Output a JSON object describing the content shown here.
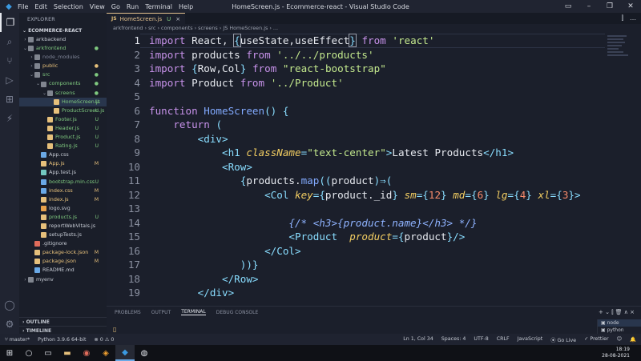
{
  "window": {
    "title": "HomeScreen.js - Ecommerce-react - Visual Studio Code",
    "menu": [
      "File",
      "Edit",
      "Selection",
      "View",
      "Go",
      "Run",
      "Terminal",
      "Help"
    ]
  },
  "sidebar": {
    "header": "EXPLORER",
    "section": "ECOMMERCE-REACT",
    "items": [
      {
        "name": "arkbackend",
        "indent": 0,
        "chev": "›",
        "icon": "folder-icon",
        "color": "plain",
        "badge": "",
        "sel": false
      },
      {
        "name": "arkfrontend",
        "indent": 0,
        "chev": "⌄",
        "icon": "folder-open-icon",
        "color": "green",
        "badge": "●",
        "sel": false
      },
      {
        "name": "node_modules",
        "indent": 1,
        "chev": "›",
        "icon": "folder-icon",
        "color": "grey",
        "badge": "",
        "sel": false
      },
      {
        "name": "public",
        "indent": 1,
        "chev": "›",
        "icon": "folder-icon",
        "color": "yellow",
        "badge": "●",
        "sel": false
      },
      {
        "name": "src",
        "indent": 1,
        "chev": "⌄",
        "icon": "folder-open-icon",
        "color": "green",
        "badge": "●",
        "sel": false
      },
      {
        "name": "components",
        "indent": 2,
        "chev": "⌄",
        "icon": "folder-open-icon",
        "color": "green",
        "badge": "●",
        "sel": false
      },
      {
        "name": "screens",
        "indent": 3,
        "chev": "⌄",
        "icon": "folder-open-icon",
        "color": "green",
        "badge": "●",
        "sel": false
      },
      {
        "name": "HomeScreen.js",
        "indent": 4,
        "chev": "",
        "icon": "js-file-icon",
        "color": "green",
        "badge": "U",
        "sel": true
      },
      {
        "name": "ProductScreen.js",
        "indent": 4,
        "chev": "",
        "icon": "js-file-icon",
        "color": "green",
        "badge": "U",
        "sel": false
      },
      {
        "name": "Footer.js",
        "indent": 3,
        "chev": "",
        "icon": "js-file-icon",
        "color": "green",
        "badge": "U",
        "sel": false
      },
      {
        "name": "Header.js",
        "indent": 3,
        "chev": "",
        "icon": "js-file-icon",
        "color": "green",
        "badge": "U",
        "sel": false
      },
      {
        "name": "Product.js",
        "indent": 3,
        "chev": "",
        "icon": "js-file-icon",
        "color": "green",
        "badge": "U",
        "sel": false
      },
      {
        "name": "Rating.js",
        "indent": 3,
        "chev": "",
        "icon": "js-file-icon",
        "color": "green",
        "badge": "U",
        "sel": false
      },
      {
        "name": "App.css",
        "indent": 2,
        "chev": "",
        "icon": "css-file-icon",
        "color": "plain",
        "badge": "",
        "sel": false
      },
      {
        "name": "App.js",
        "indent": 2,
        "chev": "",
        "icon": "js-file-icon",
        "color": "yellow",
        "badge": "M",
        "sel": false
      },
      {
        "name": "App.test.js",
        "indent": 2,
        "chev": "",
        "icon": "test-file-icon",
        "color": "plain",
        "badge": "",
        "sel": false
      },
      {
        "name": "bootstrap.min.css",
        "indent": 2,
        "chev": "",
        "icon": "css-file-icon",
        "color": "green",
        "badge": "U",
        "sel": false
      },
      {
        "name": "index.css",
        "indent": 2,
        "chev": "",
        "icon": "css-file-icon",
        "color": "yellow",
        "badge": "M",
        "sel": false
      },
      {
        "name": "index.js",
        "indent": 2,
        "chev": "",
        "icon": "js-file-icon",
        "color": "yellow",
        "badge": "M",
        "sel": false
      },
      {
        "name": "logo.svg",
        "indent": 2,
        "chev": "",
        "icon": "svg-file-icon",
        "color": "plain",
        "badge": "",
        "sel": false
      },
      {
        "name": "products.js",
        "indent": 2,
        "chev": "",
        "icon": "js-file-icon",
        "color": "green",
        "badge": "U",
        "sel": false
      },
      {
        "name": "reportWebVitals.js",
        "indent": 2,
        "chev": "",
        "icon": "js-file-icon",
        "color": "plain",
        "badge": "",
        "sel": false
      },
      {
        "name": "setupTests.js",
        "indent": 2,
        "chev": "",
        "icon": "js-file-icon",
        "color": "plain",
        "badge": "",
        "sel": false
      },
      {
        "name": ".gitignore",
        "indent": 1,
        "chev": "",
        "icon": "git-file-icon",
        "color": "plain",
        "badge": "",
        "sel": false
      },
      {
        "name": "package-lock.json",
        "indent": 1,
        "chev": "",
        "icon": "json-file-icon",
        "color": "yellow",
        "badge": "M",
        "sel": false
      },
      {
        "name": "package.json",
        "indent": 1,
        "chev": "",
        "icon": "json-file-icon",
        "color": "yellow",
        "badge": "M",
        "sel": false
      },
      {
        "name": "README.md",
        "indent": 1,
        "chev": "",
        "icon": "markdown-file-icon",
        "color": "plain",
        "badge": "",
        "sel": false
      },
      {
        "name": "myenv",
        "indent": 0,
        "chev": "›",
        "icon": "folder-icon",
        "color": "plain",
        "badge": "",
        "sel": false
      }
    ],
    "outline": "OUTLINE",
    "timeline": "TIMELINE"
  },
  "editor": {
    "tab": {
      "label": "HomeScreen.js",
      "status": "U",
      "lang": "JS"
    },
    "breadcrumb": "arkfrontend › src › components › screens › JS HomeScreen.js › ...",
    "current_line": 1,
    "lines": [
      {
        "n": "1",
        "html": "<span class='kw'>import</span> React, <span class='punc hl'>{</span>useState,useEffect<span class='punc hl'>}</span> <span class='kw'>from</span> <span class='str'>'react'</span>"
      },
      {
        "n": "2",
        "html": "<span class='kw'>import</span> products <span class='kw'>from</span> <span class='str'>'../../products'</span>"
      },
      {
        "n": "3",
        "html": "<span class='kw'>import</span> <span class='punc'>{</span>Row,Col<span class='punc'>}</span> <span class='kw'>from</span> <span class='str'>\"react-bootstrap\"</span>"
      },
      {
        "n": "4",
        "html": "<span class='kw'>import</span> Product <span class='kw'>from</span> <span class='str'>'../Product'</span>"
      },
      {
        "n": "5",
        "html": ""
      },
      {
        "n": "6",
        "html": "<span class='kw'>function</span> <span class='fn'>HomeScreen</span><span class='punc'>()</span> <span class='punc'>{</span>"
      },
      {
        "n": "7",
        "html": "    <span class='kw'>return</span> <span class='punc'>(</span>"
      },
      {
        "n": "8",
        "html": "        <span class='punc'>&lt;</span><span class='tag'>div</span><span class='punc'>&gt;</span>"
      },
      {
        "n": "9",
        "html": "            <span class='punc'>&lt;</span><span class='tag'>h1</span> <span class='attr'>className</span><span class='punc'>=</span><span class='str'>\"text-center\"</span><span class='punc'>&gt;</span>Latest Products<span class='punc'>&lt;/</span><span class='tag'>h1</span><span class='punc'>&gt;</span>"
      },
      {
        "n": "10",
        "html": "            <span class='punc'>&lt;</span><span class='tag'>Row</span><span class='punc'>&gt;</span>"
      },
      {
        "n": "11",
        "html": "               <span class='punc'>{</span>products.<span class='fn'>map</span><span class='punc'>((</span>product<span class='punc'>)⇒(</span>"
      },
      {
        "n": "12",
        "html": "                   <span class='punc'>&lt;</span><span class='tag'>Col</span> <span class='attr'>key</span><span class='punc'>={</span>product._id<span class='punc'>}</span> <span class='attr'>sm</span><span class='punc'>={</span><span class='num'>12</span><span class='punc'>}</span> <span class='attr'>md</span><span class='punc'>={</span><span class='num'>6</span><span class='punc'>}</span> <span class='attr'>lg</span><span class='punc'>={</span><span class='num'>4</span><span class='punc'>}</span> <span class='attr'>xl</span><span class='punc'>={</span><span class='num'>3</span><span class='punc'>}&gt;</span>"
      },
      {
        "n": "13",
        "html": ""
      },
      {
        "n": "14",
        "html": "                       <span class='cmt'>{/* &lt;h3&gt;{product.name}&lt;/h3&gt; */}</span>"
      },
      {
        "n": "15",
        "html": "                       <span class='punc'>&lt;</span><span class='tag'>Product</span>  <span class='attr'>product</span><span class='punc'>={</span>product<span class='punc'>}</span><span class='punc'>/&gt;</span>"
      },
      {
        "n": "16",
        "html": "                   <span class='punc'>&lt;/</span><span class='tag'>Col</span><span class='punc'>&gt;</span>"
      },
      {
        "n": "17",
        "html": "               <span class='punc'>))}</span>"
      },
      {
        "n": "18",
        "html": "            <span class='punc'>&lt;/</span><span class='tag'>Row</span><span class='punc'>&gt;</span>"
      },
      {
        "n": "19",
        "html": "        <span class='punc'>&lt;/</span><span class='tag'>div</span><span class='punc'>&gt;</span>"
      }
    ]
  },
  "panel": {
    "tabs": [
      "PROBLEMS",
      "OUTPUT",
      "TERMINAL",
      "DEBUG CONSOLE"
    ],
    "active_tab": "TERMINAL",
    "controls": "+ ⌄ ⫿ 🗑 ∧ ×",
    "prompt": "▯",
    "terminals": [
      "node",
      "python"
    ]
  },
  "statusbar": {
    "branch": "master*",
    "python": "Python 3.9.6 64-bit",
    "problems": "⊗ 0 ⚠ 0",
    "position": "Ln 1, Col 34",
    "spaces": "Spaces: 4",
    "encoding": "UTF-8",
    "eol": "CRLF",
    "language": "JavaScript",
    "golive": "⦿ Go Live",
    "prettier": "✓ Prettier"
  },
  "taskbar": {
    "time": "18:19",
    "date": "28-08-2021"
  }
}
